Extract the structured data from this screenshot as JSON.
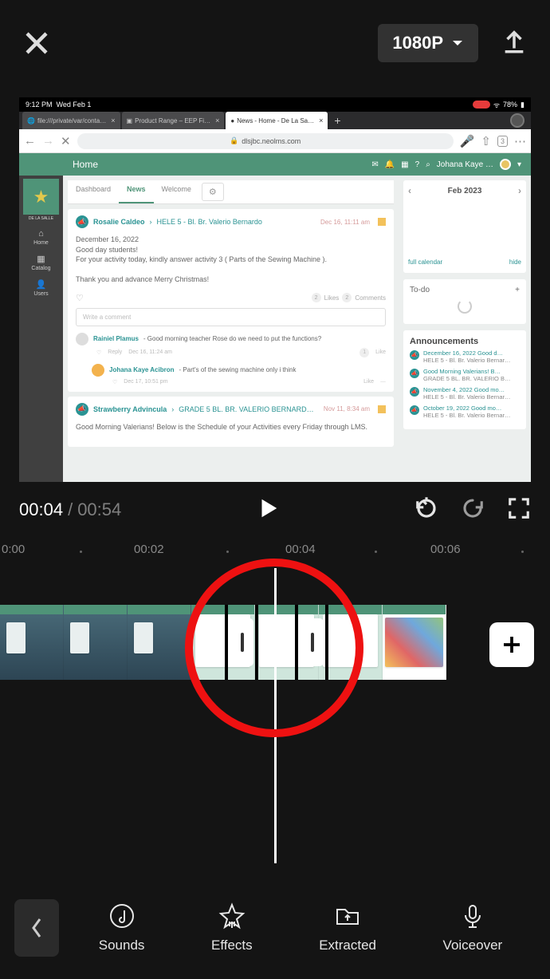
{
  "topbar": {
    "resolution_label": "1080P"
  },
  "transport": {
    "current_time": "00:04",
    "separator": "/",
    "total_time": "00:54"
  },
  "ruler": {
    "t0": "0:00",
    "t2": "00:02",
    "t4": "00:04",
    "t6": "00:06"
  },
  "bottom": {
    "sounds": "Sounds",
    "effects": "Effects",
    "extracted": "Extracted",
    "voiceover": "Voiceover"
  },
  "preview": {
    "ios_status": {
      "time": "9:12 PM",
      "date": "Wed Feb 1",
      "battery": "78%"
    },
    "tabs": {
      "t1": "file:///private/var/conta…",
      "t2": "Product Range – EEP Fi…",
      "t3": "News - Home - De La Sa…"
    },
    "url": "dlsjbc.neolms.com",
    "lms": {
      "header_title": "Home",
      "user_name": "Johana Kaye …",
      "side": {
        "home": "Home",
        "catalog": "Catalog",
        "users": "Users",
        "logo_sub": "DE LA SALLE"
      },
      "tabs": {
        "dashboard": "Dashboard",
        "news": "News",
        "welcome": "Welcome"
      },
      "post1": {
        "author": "Rosalie Caldeo",
        "class": "HELE 5 - Bl. Br. Valerio Bernardo",
        "time": "Dec 16, 11:11 am",
        "line1": "December 16, 2022",
        "line2": "Good day students!",
        "line3": "For your activity today, kindly answer activity 3 ( Parts of the Sewing Machine ).",
        "line4": "Thank you and advance Merry Christmas!",
        "likes_n": "2",
        "likes": "Likes",
        "comments_n": "2",
        "comments": "Comments",
        "comment_ph": "Write a comment"
      },
      "reply1": {
        "author": "Rainiel Plamus",
        "text": "- Good morning teacher Rose do we need to put the functions?",
        "reply_label": "Reply",
        "time": "Dec 16, 11:24 am",
        "like_n": "1",
        "like": "Like"
      },
      "reply2": {
        "author": "Johana Kaye Acibron",
        "text": "- Part's of the sewing machine only i think",
        "time": "Dec 17, 10:51 pm",
        "like": "Like"
      },
      "post2": {
        "author": "Strawberry Advincula",
        "class": "GRADE 5 BL. BR. VALERIO BERNARD…",
        "time": "Nov 11, 8:34 am",
        "body": "Good Morning Valerians! Below is the Schedule of your Activities every Friday through LMS."
      },
      "calendar": {
        "month": "Feb 2023",
        "full": "full calendar",
        "hide": "hide"
      },
      "todo": {
        "title": "To-do"
      },
      "ann": {
        "title": "Announcements",
        "a1_t": "December 16, 2022 Good d…",
        "a1_s": "HELE 5 - Bl. Br. Valerio Bernar…",
        "a2_t": "Good Morning Valerians! B…",
        "a2_s": "GRADE 5 BL. BR. VALERIO B…",
        "a3_t": "November 4, 2022 Good mo…",
        "a3_s": "HELE 5 - Bl. Br. Valerio Bernar…",
        "a4_t": "October 19, 2022 Good mo…",
        "a4_s": "HELE 5 - Bl. Br. Valerio Bernar…"
      }
    }
  }
}
